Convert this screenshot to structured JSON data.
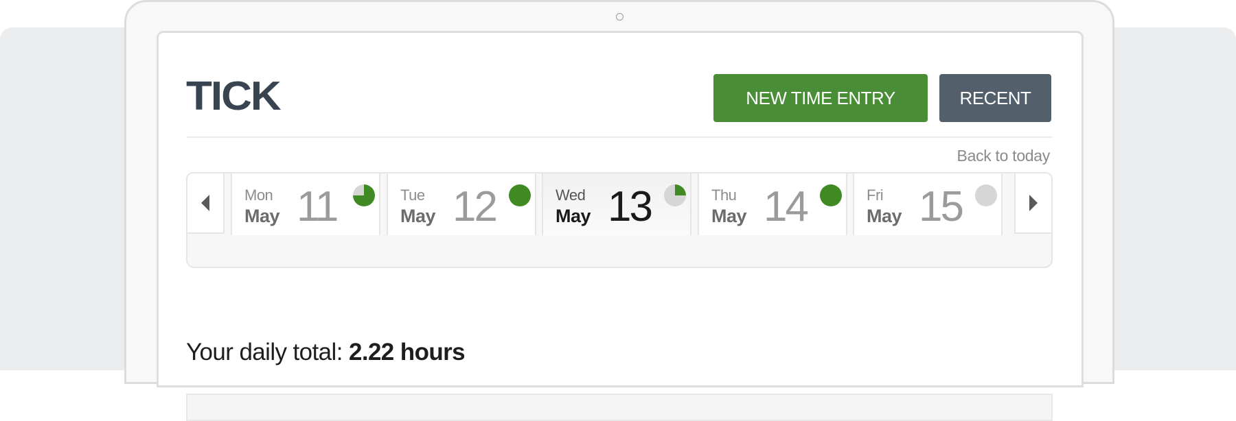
{
  "app": {
    "logo_text": "TICK",
    "accent_green": "#4a8d37",
    "accent_slate": "#53606b"
  },
  "header": {
    "new_time_entry_label": "NEW TIME ENTRY",
    "recent_label": "RECENT"
  },
  "date_strip": {
    "back_to_today_label": "Back to today",
    "prev_icon": "triangle-left-icon",
    "next_icon": "triangle-right-icon",
    "days": [
      {
        "dow": "Mon",
        "month": "May",
        "day": "11",
        "progress": 0.75,
        "status_color": "#3f8a22",
        "selected": false
      },
      {
        "dow": "Tue",
        "month": "May",
        "day": "12",
        "progress": 1.0,
        "status_color": "#3f8a22",
        "selected": false
      },
      {
        "dow": "Wed",
        "month": "May",
        "day": "13",
        "progress": 0.25,
        "status_color": "#3f8a22",
        "selected": true
      },
      {
        "dow": "Thu",
        "month": "May",
        "day": "14",
        "progress": 1.0,
        "status_color": "#3f8a22",
        "selected": false
      },
      {
        "dow": "Fri",
        "month": "May",
        "day": "15",
        "progress": 0.0,
        "status_color": "#3f8a22",
        "selected": false
      }
    ]
  },
  "summary": {
    "daily_total_prefix": "Your daily total:",
    "daily_total_value": "2.22 hours"
  }
}
